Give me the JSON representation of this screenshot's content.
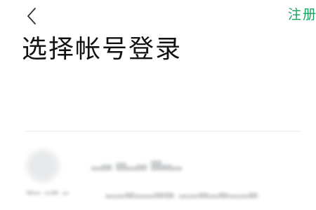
{
  "header": {
    "back_icon": "chevron-left-icon",
    "register_label": "注册"
  },
  "page": {
    "title": "选择帐号登录"
  },
  "colors": {
    "accent": "#1aa260",
    "title": "#111111",
    "divider": "#ececec"
  }
}
